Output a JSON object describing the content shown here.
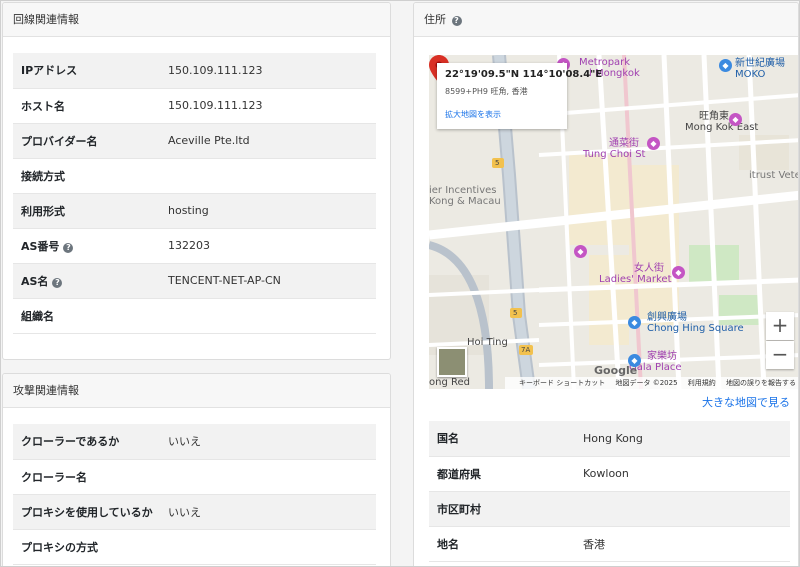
{
  "line_info": {
    "title": "回線関連情報",
    "rows": [
      {
        "label": "IPアドレス",
        "value": "150.109.111.123",
        "help": false
      },
      {
        "label": "ホスト名",
        "value": "150.109.111.123",
        "help": false
      },
      {
        "label": "プロバイダー名",
        "value": "Aceville Pte.ltd",
        "help": false
      },
      {
        "label": "接続方式",
        "value": "",
        "help": false
      },
      {
        "label": "利用形式",
        "value": "hosting",
        "help": false
      },
      {
        "label": "AS番号",
        "value": "132203",
        "help": true
      },
      {
        "label": "AS名",
        "value": "TENCENT-NET-AP-CN",
        "help": true
      },
      {
        "label": "組織名",
        "value": "",
        "help": false
      }
    ]
  },
  "attack_info": {
    "title": "攻撃関連情報",
    "rows": [
      {
        "label": "クローラーであるか",
        "value": "いいえ"
      },
      {
        "label": "クローラー名",
        "value": ""
      },
      {
        "label": "プロキシを使用しているか",
        "value": "いいえ"
      },
      {
        "label": "プロキシの方式",
        "value": ""
      }
    ]
  },
  "address": {
    "title": "住所",
    "help_icon": "?",
    "map": {
      "coords": "22°19'09.5\"N 114°10'08.4\"E",
      "plus_code": "8599+PH9 旺角, 香港",
      "enlarge_link": "拡大地図を表示",
      "zoom_in": "+",
      "zoom_out": "−",
      "google": "Google",
      "footer": [
        "キーボード ショートカット",
        "地図データ ©2025",
        "利用規約",
        "地図の誤りを報告する"
      ],
      "labels": {
        "metropark": "Metropark",
        "mongkok": "l Mongkok",
        "mongkok_east": "Mong Kok East",
        "mongkok_east_zh": "旺角東",
        "moko_zh": "新世紀廣場",
        "moko": "MOKO",
        "tung_choi_zh": "通菜街",
        "tung_choi": "Tung Choi St",
        "incentives": "ier Incentives",
        "kong_macau": "Kong & Macau",
        "ladies_zh": "女人街",
        "ladies": "Ladies' Market",
        "chong_hing_zh": "創興廣場",
        "chong_hing": "Chong Hing Square",
        "gala_zh": "家樂坊",
        "gala": "Gala Place",
        "hoi_ting": "Hoi Ting",
        "kong_red": "ong Red",
        "itrust": "itrust Veteri",
        "road_5a": "5",
        "road_5b": "5",
        "road_7a": "7A"
      }
    },
    "big_map_link": "大きな地図で見る",
    "rows": [
      {
        "label": "国名",
        "value": "Hong Kong"
      },
      {
        "label": "都道府県",
        "value": "Kowloon"
      },
      {
        "label": "市区町村",
        "value": ""
      },
      {
        "label": "地名",
        "value": "香港"
      }
    ]
  },
  "colors": {
    "link": "#1a73e8",
    "pin": "#d93025",
    "poi_purple": "#c455c4",
    "poi_blue": "#3b8ae0"
  }
}
